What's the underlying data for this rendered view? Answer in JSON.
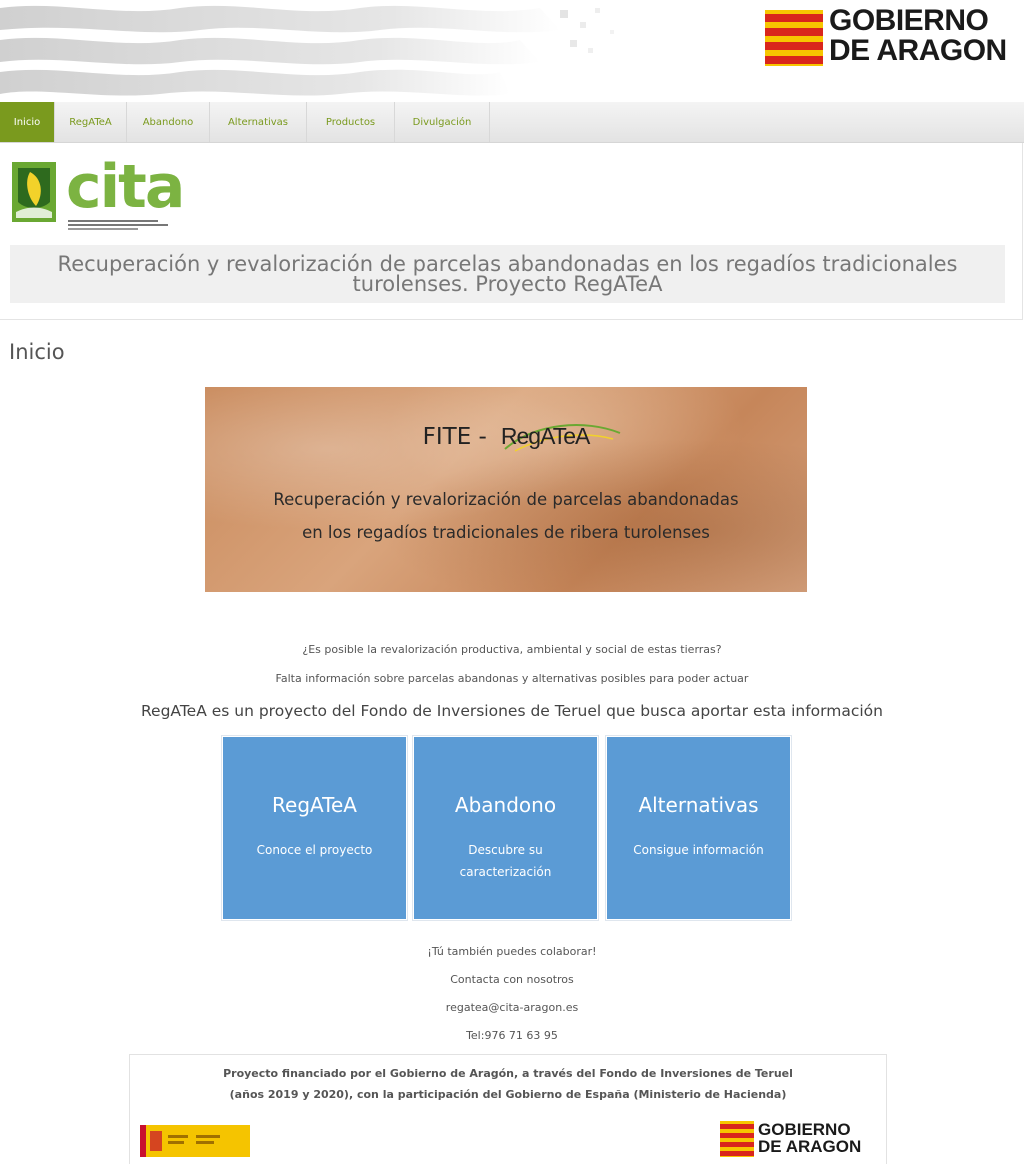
{
  "header": {
    "logo_text": "GOBIERNO\nDE ARAGON"
  },
  "nav": {
    "items": [
      {
        "label": "Inicio",
        "active": true
      },
      {
        "label": "RegATeA",
        "active": false
      },
      {
        "label": "Abandono",
        "active": false
      },
      {
        "label": "Alternativas",
        "active": false
      },
      {
        "label": "Productos",
        "active": false
      },
      {
        "label": "Divulgación",
        "active": false
      }
    ]
  },
  "site": {
    "logo_text": "cita",
    "title": "Recuperación y revalorización de parcelas abandonadas en los regadíos tradicionales turolenses. Proyecto RegATeA"
  },
  "page": {
    "title": "Inicio"
  },
  "hero": {
    "prefix": "FITE -",
    "brand": "RegATeA",
    "line1": "Recuperación y revalorización de parcelas abandonadas",
    "line2": "en los regadíos tradicionales de ribera turolenses"
  },
  "intro": {
    "question": "¿Es posible la revalorización productiva, ambiental y social de estas tierras?",
    "lack": "Falta información sobre parcelas abandonas y alternativas posibles para poder actuar",
    "statement": "RegATeA es un proyecto del Fondo de Inversiones de Teruel que busca aportar esta información"
  },
  "tiles": [
    {
      "title": "RegATeA",
      "subtitle": "Conoce el proyecto"
    },
    {
      "title": "Abandono",
      "subtitle": "Descubre su caracterización"
    },
    {
      "title": "Alternativas",
      "subtitle": "Consigue información"
    }
  ],
  "contact": {
    "collaborate": "¡Tú también puedes colaborar!",
    "contact_us": "Contacta con nosotros",
    "email": "regatea@cita-aragon.es",
    "phone": "Tel:976 71 63 95"
  },
  "funding": {
    "line1": "Proyecto financiado por el Gobierno de Aragón, a través del Fondo de Inversiones de Teruel",
    "line2": "(años 2019 y 2020), con la participación del Gobierno de España (Ministerio de Hacienda)",
    "logo_text": "GOBIERNO\nDE ARAGON"
  },
  "colors": {
    "nav_accent": "#7a9a1e",
    "tile_blue": "#5b9bd5",
    "aragon_red": "#d9261c",
    "aragon_yellow": "#f7c600",
    "cita_green": "#7cb342"
  }
}
